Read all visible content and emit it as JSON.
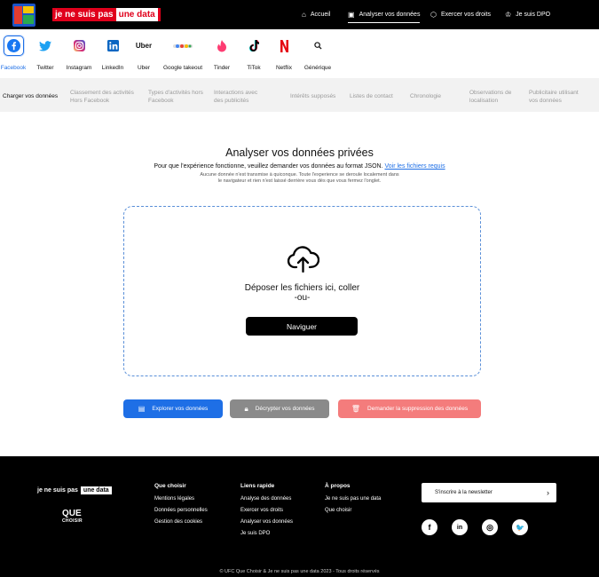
{
  "header": {
    "brand_part1": "je ne suis pas",
    "brand_part2": "une data",
    "nav": [
      {
        "label": "Accueil",
        "icon": "home-icon"
      },
      {
        "label": "Analyser vos données",
        "icon": "chart-icon",
        "active": true
      },
      {
        "label": "Exercer vos droits",
        "icon": "cube-icon"
      },
      {
        "label": "Je suis DPO",
        "icon": "crown-icon"
      }
    ]
  },
  "platforms": [
    {
      "label": "Facebook",
      "icon": "facebook-icon",
      "color": "#1877f2",
      "active": true
    },
    {
      "label": "Twitter",
      "icon": "twitter-icon",
      "color": "#1da1f2"
    },
    {
      "label": "Instagram",
      "icon": "instagram-icon",
      "color": "#d62976"
    },
    {
      "label": "LinkedIn",
      "icon": "linkedin-icon",
      "color": "#0a66c2"
    },
    {
      "label": "Uber",
      "icon": "uber-icon",
      "color": "#000000",
      "logo_text": "Uber"
    },
    {
      "label": "Google takeout",
      "icon": "google-takeout-icon",
      "color": "#777777"
    },
    {
      "label": "Tinder",
      "icon": "tinder-icon",
      "color": "#fe3c72"
    },
    {
      "label": "TiTok",
      "icon": "tiktok-icon",
      "color": "#000000"
    },
    {
      "label": "Netflix",
      "icon": "netflix-icon",
      "color": "#e50914"
    },
    {
      "label": "Générique",
      "icon": "search-icon",
      "color": "#111111"
    }
  ],
  "subnav": [
    {
      "label": "Charger vos données"
    },
    {
      "label": "Classement des activités Hors Facebook"
    },
    {
      "label": "Types d'activités hors Facebook"
    },
    {
      "label": "Interactions avec des publicités"
    },
    {
      "label": "Intérêts supposés"
    },
    {
      "label": "Listes de contact"
    },
    {
      "label": "Chronologie"
    },
    {
      "label": "Observations de localisation"
    },
    {
      "label": "Publicitaire utilisant vos données"
    }
  ],
  "main": {
    "title": "Analyser vos données privées",
    "lead": "Pour que l'expérience fonctionne, veuillez demander vos données au format JSON.",
    "lead_link": "Voir les fichiers requis",
    "fine_print": "Aucune donnée n'est transmise à quiconque. Toute l'experience se deroule localement dans le navigateur et rien n'est laissé derrière vous dès que vous fermez l'onglet.",
    "drop_text": "Déposer les fichiers ici, coller",
    "drop_or": "-ou-",
    "browse_label": "Naviguer"
  },
  "actions": [
    {
      "label": "Explorer vos données",
      "icon": "database-icon",
      "color": "#1e6fe6"
    },
    {
      "label": "Décrypter vos données",
      "icon": "lock-icon",
      "color": "#8a8a8a"
    },
    {
      "label": "Demander la suppression des données",
      "icon": "trash-icon",
      "color": "#f47c7c"
    }
  ],
  "footer": {
    "brand_part1": "je ne suis pas",
    "brand_part2": "une data",
    "que": "QUE",
    "choisir": "CHOISIR",
    "columns": [
      {
        "heading": "Que choisir",
        "items": [
          "Mentions légales",
          "Données personnelles",
          "Gestion des cookies"
        ]
      },
      {
        "heading": "Liens rapide",
        "items": [
          "Analyse des données",
          "Exercer vos droits",
          "Analyser vos données",
          "Je suis DPO"
        ]
      },
      {
        "heading": "À propos",
        "items": [
          "Je ne suis pas une data",
          "Que choisir"
        ]
      }
    ],
    "newsletter_label": "S'inscrire à la newsletter",
    "social": [
      {
        "icon": "facebook-icon",
        "glyph": "f"
      },
      {
        "icon": "linkedin-icon",
        "glyph": "in"
      },
      {
        "icon": "instagram-icon",
        "glyph": "◎"
      },
      {
        "icon": "twitter-icon",
        "glyph": "🐦"
      }
    ],
    "copyright": "© UFC Que Choisir & Je ne suis pas une data 2023 - Tous droits réservés"
  }
}
